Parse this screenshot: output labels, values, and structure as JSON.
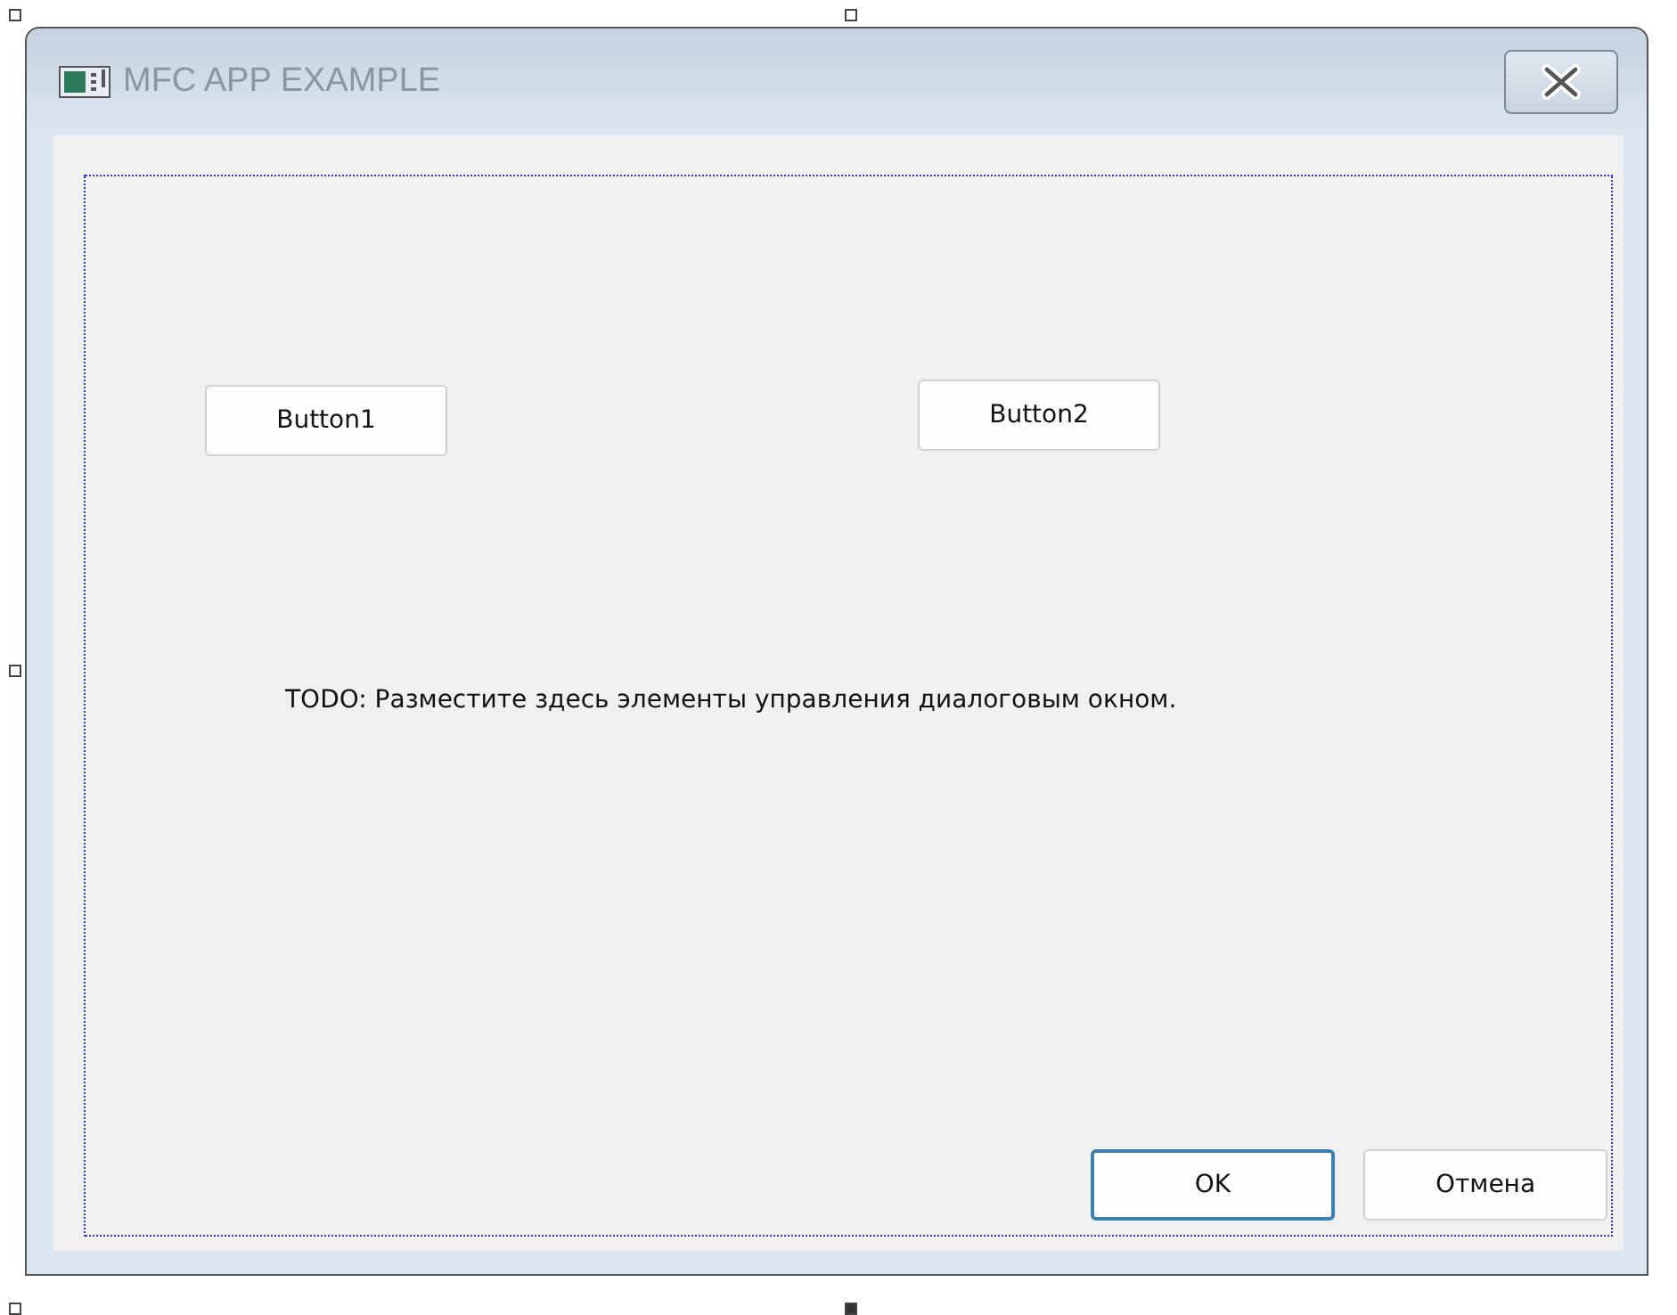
{
  "window": {
    "title": "MFC APP EXAMPLE"
  },
  "dialog": {
    "buttons": [
      {
        "label": "Button1",
        "default": false
      },
      {
        "label": "Button2",
        "default": false
      }
    ],
    "todo_text": "TODO: Разместите здесь элементы управления диалоговым окном.",
    "footer_buttons": [
      {
        "label": "OK",
        "default": true
      },
      {
        "label": "Отмена",
        "default": false
      }
    ]
  }
}
